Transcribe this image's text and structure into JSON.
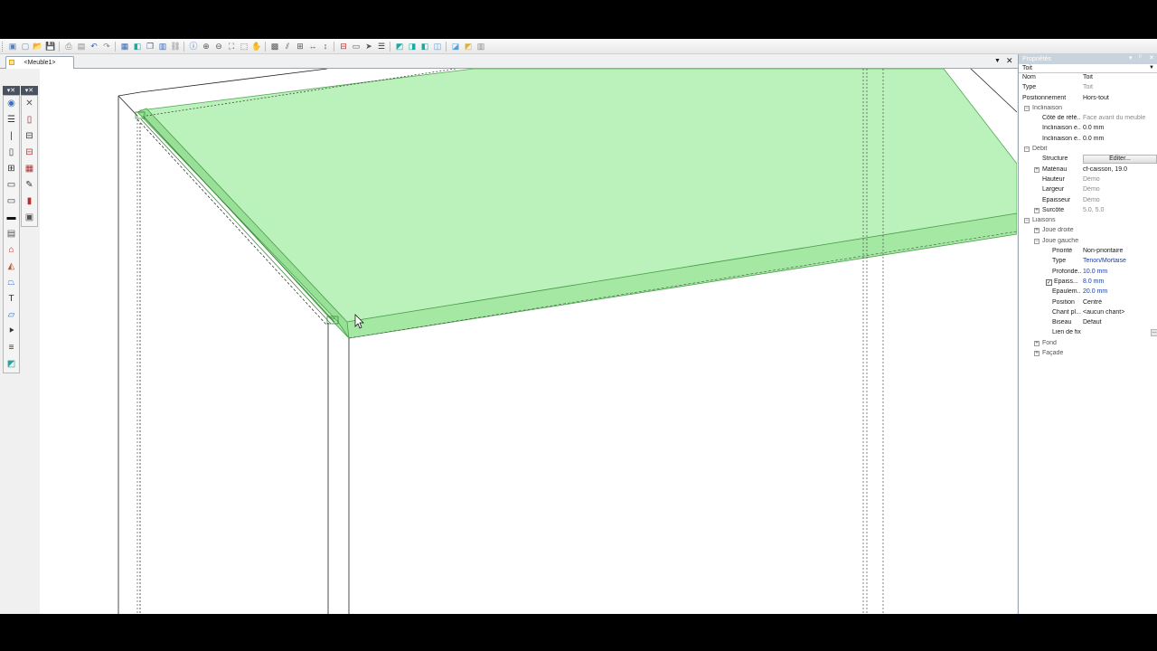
{
  "toolbar": {
    "icons": [
      "new-window-icon",
      "new-file-icon",
      "open-folder-icon",
      "save-icon",
      "print-icon",
      "print-preview-icon",
      "undo-icon",
      "redo-icon",
      "properties-icon",
      "box-icon",
      "copy-icon",
      "layers-icon",
      "link-icon",
      "info-icon",
      "zoom-in-icon",
      "zoom-out-icon",
      "zoom-extents-icon",
      "zoom-window-icon",
      "pan-hand-icon",
      "snap-grid-icon",
      "align-icon",
      "grid-icon",
      "dimension-h-icon",
      "dimension-v-icon",
      "section-icon",
      "drawer-icon",
      "arrow-icon",
      "list-icon",
      "shaded-icon",
      "wireframe-icon",
      "view-front-icon",
      "view-side-icon",
      "view-top-icon",
      "view-iso-icon",
      "render-icon"
    ],
    "glyphs": [
      "▣",
      "▢",
      "📂",
      "💾",
      "⎙",
      "▤",
      "↶",
      "↷",
      "▦",
      "◧",
      "❐",
      "▥",
      "⛓",
      "ⓘ",
      "⊕",
      "⊖",
      "⛶",
      "⬚",
      "✋",
      "▩",
      "⫽",
      "⊞",
      "↔",
      "↕",
      "⊟",
      "▭",
      "➤",
      "☰",
      "◩",
      "◨",
      "◧",
      "◫",
      "◪",
      "◩",
      "▥"
    ],
    "colors": [
      "#5a7fb5",
      "#7a8aa0",
      "#d9a441",
      "#3a66b0",
      "#888",
      "#888",
      "#3a66b0",
      "#888",
      "#3a66b0",
      "#1da8a0",
      "#3a66b0",
      "#3a66b0",
      "#888",
      "#3a66b0",
      "#555",
      "#555",
      "#555",
      "#555",
      "#555",
      "#555",
      "#555",
      "#555",
      "#555",
      "#555",
      "#c62828",
      "#555",
      "#555",
      "#333",
      "#1da8a0",
      "#1da8a0",
      "#1da8a0",
      "#5a9fd4",
      "#5a9fd4",
      "#d9b341",
      "#888"
    ]
  },
  "doc_tab": {
    "label": "<Meuble1>",
    "close": "✕",
    "dropdown": "▼"
  },
  "palette": {
    "head_left": "▾✕",
    "head_right": "▾✕",
    "left": [
      {
        "icon": "compass-icon",
        "glyph": "◉",
        "color": "#2a6fcf"
      },
      {
        "icon": "shelves-icon",
        "glyph": "☰",
        "color": "#333"
      },
      {
        "icon": "vertical-panel-icon",
        "glyph": "|",
        "color": "#333"
      },
      {
        "icon": "door-icon",
        "glyph": "▯",
        "color": "#333"
      },
      {
        "icon": "frame-icon",
        "glyph": "⊞",
        "color": "#333"
      },
      {
        "icon": "drawer-front-icon",
        "glyph": "▭",
        "color": "#333"
      },
      {
        "icon": "drawer-icon",
        "glyph": "▭",
        "color": "#333"
      },
      {
        "icon": "plinth-icon",
        "glyph": "▬",
        "color": "#111"
      },
      {
        "icon": "stack-icon",
        "glyph": "▤",
        "color": "#555"
      },
      {
        "icon": "roof-icon",
        "glyph": "⌂",
        "color": "#c62828"
      },
      {
        "icon": "profile-icon",
        "glyph": "◭",
        "color": "#c2562b"
      },
      {
        "icon": "trapeze-icon",
        "glyph": "⏢",
        "color": "#2a6fcf"
      },
      {
        "icon": "hanger-icon",
        "glyph": "T",
        "color": "#333"
      },
      {
        "icon": "slant-icon",
        "glyph": "▱",
        "color": "#2a6fcf"
      },
      {
        "icon": "split-icon",
        "glyph": "⯈",
        "color": "#333"
      },
      {
        "icon": "list-lines-icon",
        "glyph": "≡",
        "color": "#333"
      },
      {
        "icon": "cube-icon",
        "glyph": "◩",
        "color": "#1da8a0"
      }
    ],
    "right": [
      {
        "icon": "tools-icon",
        "glyph": "✕",
        "color": "#555"
      },
      {
        "icon": "panel-red-icon",
        "glyph": "▯",
        "color": "#8b1a1a"
      },
      {
        "icon": "shelf-icon",
        "glyph": "⊟",
        "color": "#333"
      },
      {
        "icon": "drawer-red-icon",
        "glyph": "⊟",
        "color": "#c62828"
      },
      {
        "icon": "grid-red-icon",
        "glyph": "▦",
        "color": "#a33"
      },
      {
        "icon": "pin-icon",
        "glyph": "✎",
        "color": "#333"
      },
      {
        "icon": "hardware-icon",
        "glyph": "▮",
        "color": "#c62828"
      },
      {
        "icon": "calc-icon",
        "glyph": "▣",
        "color": "#555"
      }
    ]
  },
  "properties": {
    "title": "Propriétés",
    "title_controls": [
      "▾",
      "ᵖ",
      "✕"
    ],
    "selected_object": "Toit",
    "rows": [
      {
        "name": "Nom",
        "value": "Toit",
        "level": 0,
        "expander": "",
        "style": "",
        "vstyle": ""
      },
      {
        "name": "Type",
        "value": "Toit",
        "level": 0,
        "expander": "",
        "style": "",
        "vstyle": "grey"
      },
      {
        "name": "Positionnement",
        "value": "Hors-tout",
        "level": 0,
        "expander": "",
        "style": "",
        "vstyle": ""
      },
      {
        "name": "Inclinaison",
        "value": "",
        "level": 0,
        "expander": "−",
        "style": "cat",
        "vstyle": ""
      },
      {
        "name": "Côté de réfé...",
        "value": "Face avant du meuble",
        "level": 1,
        "expander": "",
        "style": "",
        "vstyle": "grey"
      },
      {
        "name": "Inclinaison e...",
        "value": "0.0 mm",
        "level": 1,
        "expander": "",
        "style": "",
        "vstyle": ""
      },
      {
        "name": "Inclinaison e...",
        "value": "0.0 mm",
        "level": 1,
        "expander": "",
        "style": "",
        "vstyle": ""
      },
      {
        "name": "Débit",
        "value": "",
        "level": 0,
        "expander": "−",
        "style": "cat",
        "vstyle": ""
      },
      {
        "name": "Structure",
        "value": "Editer...",
        "level": 1,
        "expander": "",
        "style": "",
        "vstyle": "button"
      },
      {
        "name": "Matériau",
        "value": "cf-caisson, 19.0",
        "level": 1,
        "expander": "+",
        "style": "",
        "vstyle": ""
      },
      {
        "name": "Hauteur",
        "value": "Démo",
        "level": 1,
        "expander": "",
        "style": "",
        "vstyle": "grey"
      },
      {
        "name": "Largeur",
        "value": "Démo",
        "level": 1,
        "expander": "",
        "style": "",
        "vstyle": "grey"
      },
      {
        "name": "Épaisseur",
        "value": "Démo",
        "level": 1,
        "expander": "",
        "style": "",
        "vstyle": "grey"
      },
      {
        "name": "Surcôte",
        "value": "5.0, 5.0",
        "level": 1,
        "expander": "+",
        "style": "",
        "vstyle": "grey"
      },
      {
        "name": "Liaisons",
        "value": "",
        "level": 0,
        "expander": "−",
        "style": "cat",
        "vstyle": ""
      },
      {
        "name": "Joue droite",
        "value": "",
        "level": 1,
        "expander": "+",
        "style": "cat",
        "vstyle": ""
      },
      {
        "name": "Joue gauche",
        "value": "",
        "level": 1,
        "expander": "−",
        "style": "cat",
        "vstyle": ""
      },
      {
        "name": "Priorité",
        "value": "Non-prioritaire",
        "level": 2,
        "expander": "",
        "style": "",
        "vstyle": ""
      },
      {
        "name": "Type",
        "value": "Tenon/Mortaise",
        "level": 2,
        "expander": "",
        "style": "",
        "vstyle": "blue"
      },
      {
        "name": "Profonde...",
        "value": "10.0 mm",
        "level": 2,
        "expander": "",
        "style": "",
        "vstyle": "blue"
      },
      {
        "name": "Épaiss...",
        "value": "8.0 mm",
        "level": 2,
        "expander": "",
        "style": "",
        "vstyle": "blue",
        "checkbox": "✓"
      },
      {
        "name": "Épaulem...",
        "value": "20.0 mm",
        "level": 2,
        "expander": "",
        "style": "",
        "vstyle": "blue"
      },
      {
        "name": "Position",
        "value": "Centré",
        "level": 2,
        "expander": "",
        "style": "",
        "vstyle": ""
      },
      {
        "name": "Chant pl...",
        "value": "<aucun chant>",
        "level": 2,
        "expander": "",
        "style": "",
        "vstyle": ""
      },
      {
        "name": "Biseau",
        "value": "Défaut",
        "level": 2,
        "expander": "",
        "style": "",
        "vstyle": ""
      },
      {
        "name": "Lien de fixation",
        "value": "",
        "level": 2,
        "expander": "",
        "style": "",
        "vstyle": "ellipsis"
      },
      {
        "name": "Fond",
        "value": "",
        "level": 1,
        "expander": "+",
        "style": "cat",
        "vstyle": ""
      },
      {
        "name": "Façade",
        "value": "",
        "level": 1,
        "expander": "+",
        "style": "cat",
        "vstyle": ""
      }
    ]
  },
  "viewport": {
    "panel_fill": "#a8f0a8",
    "panel_stroke": "#4aa04a",
    "edge_color": "#222"
  }
}
